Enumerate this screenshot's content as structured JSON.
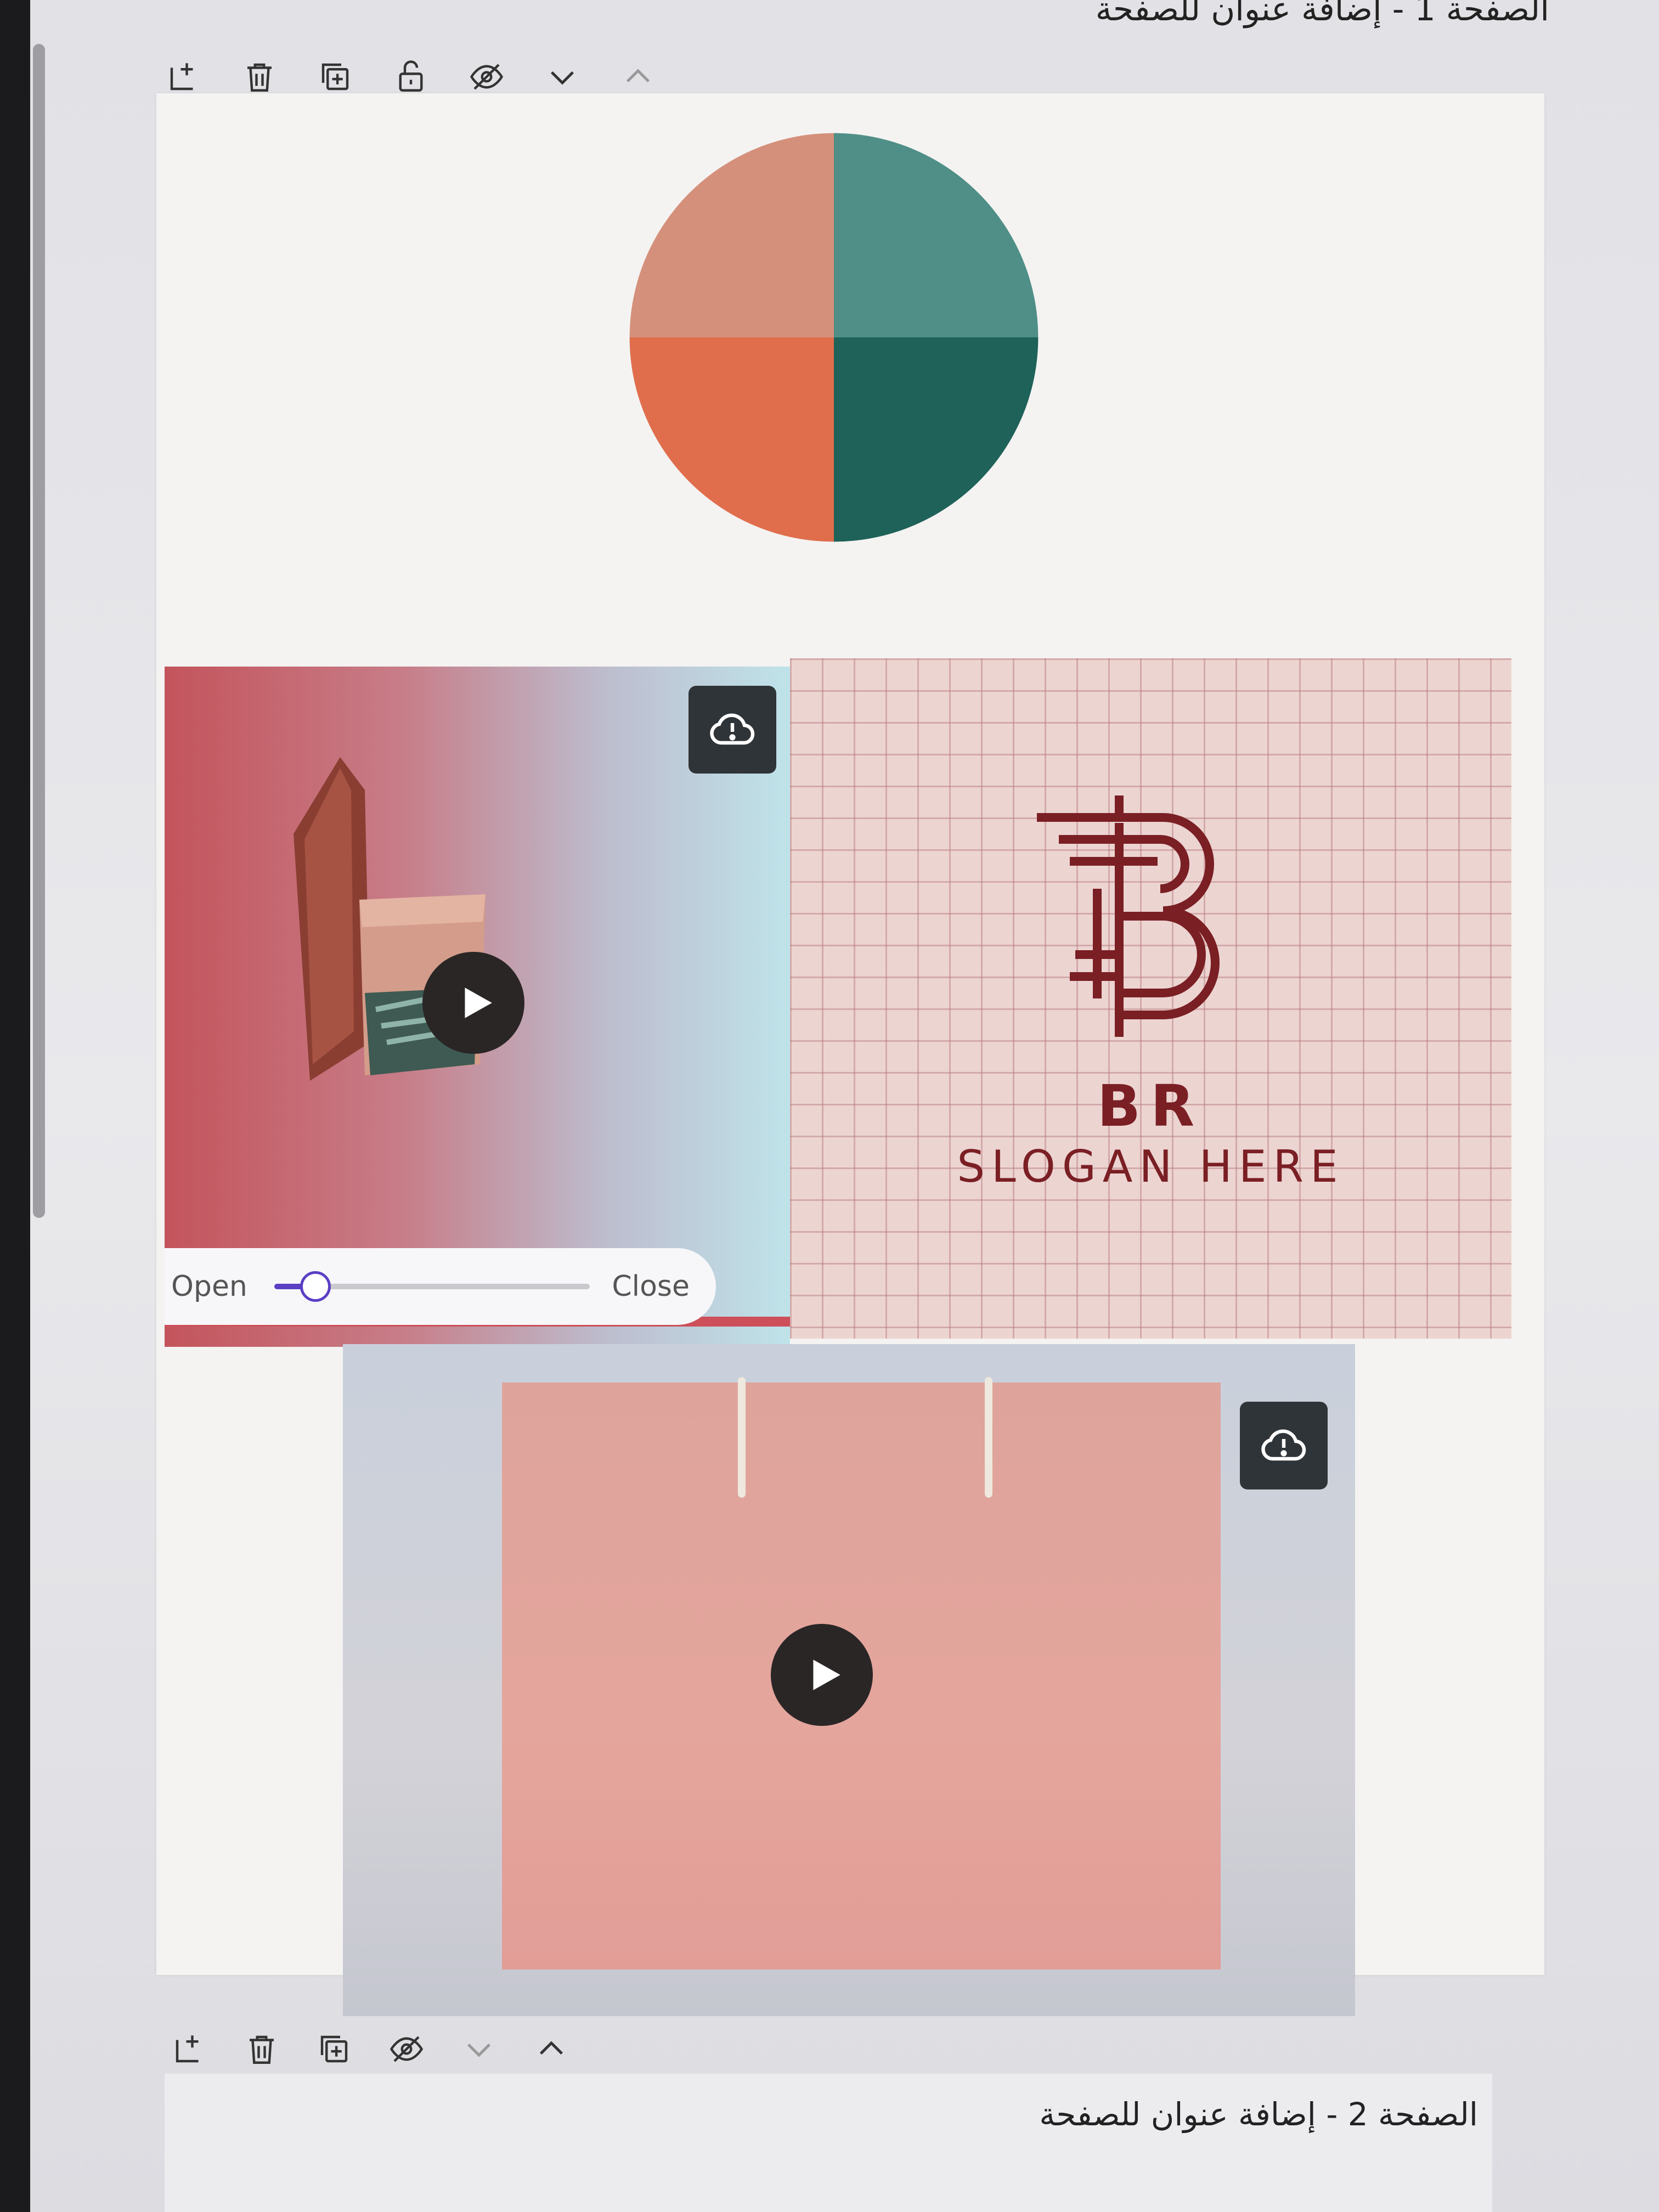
{
  "pages": [
    {
      "title": "الصفحة 1 - إضافة عنوان للصفحة"
    },
    {
      "title": "الصفحة 2 - إضافة عنوان للصفحة"
    }
  ],
  "toolbar": {
    "icons": [
      "add-page-icon",
      "trash-icon",
      "duplicate-icon",
      "lock-icon",
      "hide-icon",
      "chevron-down-icon",
      "chevron-up-icon"
    ]
  },
  "pie_chart": {
    "slices": [
      {
        "color": "#4f8f87",
        "value": 25
      },
      {
        "color": "#1e6259",
        "value": 25
      },
      {
        "color": "#e06e4c",
        "value": 25
      },
      {
        "color": "#d5907b",
        "value": 25
      }
    ]
  },
  "video_1": {
    "slider": {
      "left_label": "Open",
      "right_label": "Close",
      "value": 0.13
    }
  },
  "logo_card": {
    "brand": "BR",
    "slogan": "SLOGAN HERE",
    "color": "#7a1f24"
  },
  "colors": {
    "accent": "#5b3fc4",
    "dark_button": "#2f3438"
  }
}
